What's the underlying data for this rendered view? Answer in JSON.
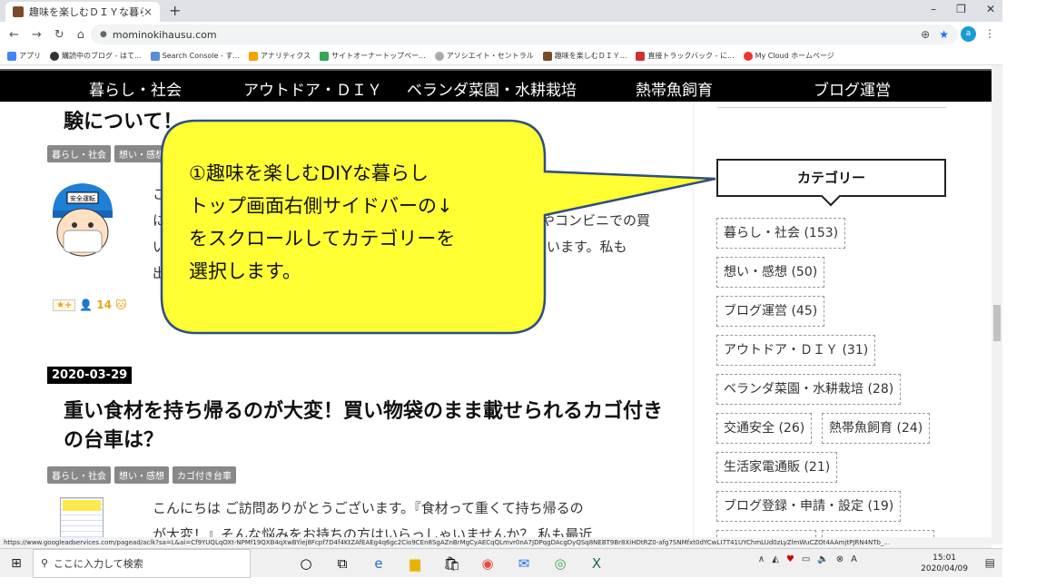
{
  "browser": {
    "tab_title": "趣味を楽しむＤＩＹな暮らし",
    "tab_close": "×",
    "new_tab": "+",
    "win_min": "–",
    "win_max": "❐",
    "win_close": "✕",
    "url": "mominokihausu.com",
    "profile_initial": "a",
    "bookmarks": [
      "アプリ",
      "購読中のブログ - はて...",
      "Search Console - す...",
      "アナリティクス",
      "サイトオーナートップペー...",
      "アソシエイト・セントラル",
      "趣味を楽しむＤＩＹ...",
      "直接トラックバック - に...",
      "My Cloud ホームページ"
    ]
  },
  "site_nav": [
    "暮らし・社会",
    "アウトドア・ＤＩＹ",
    "ベランダ菜園・水耕栽培",
    "熱帯魚飼育",
    "ブログ運営"
  ],
  "post1": {
    "title_partial": "験について！",
    "tags": [
      "暮らし・社会",
      "想い・感想"
    ],
    "avatar_badge": "安全運転",
    "excerpt": [
      "こ",
      "に",
      "い",
      "出"
    ],
    "excerpt_right": [
      "やコンビニでの買",
      "けています。私も"
    ],
    "hatena_star": "★+",
    "hatena_count": "14"
  },
  "post2": {
    "date": "2020-03-29",
    "title": "重い食材を持ち帰るのが大変！買い物袋のまま載せられるカゴ付きの台車は？",
    "tags": [
      "暮らし・社会",
      "想い・感想",
      "カゴ付き台車"
    ],
    "excerpt": [
      "こんにちは ご訪問ありがとうございます。『食材って重くて持ち帰るの",
      "が大変！』そんな悩みをお持ちの方はいらっしゃいませんか？ 私も最近"
    ]
  },
  "callout": {
    "text": "①趣味を楽しむDIYな暮らしトップ画面右側サイドバーの↓をスクロールしてカテゴリーを選択します。",
    "lines": [
      "①趣味を楽しむDIYな暮らし",
      "トップ画面右側サイドバーの↓",
      "をスクロールしてカテゴリーを",
      "選択します。"
    ]
  },
  "sidebar": {
    "category_heading": "カテゴリー",
    "categories": [
      "暮らし・社会 (153)",
      "想い・感想 (50)",
      "ブログ運営 (45)",
      "アウトドア・ＤＩＹ (31)",
      "ベランダ菜園・水耕栽培 (28)",
      "交通安全 (26)",
      "熱帯魚飼育 (24)",
      "生活家電通販 (21)",
      "ブログ登録・申請・設定 (19)"
    ]
  },
  "status_url": "https://www.googleadservices.com/pagead/aclk?sa=L&ai=Cf9YUQLqOXt-NPMf19QXB4qXwBYiej8Fcpf7D4f4KtZAfEAEg4q6gc2Cio9CEn8SgAZnBrMgCyAECqQLmvr0nA7JDPqgDAcgDyQSq8NEBT9Br8XiHDtRZ0-afg7SNMfxt0dYCwLI7T41UYChmLUd0zLyZlmWuCZOt4AAmjtPJRN4NTb_...",
  "taskbar": {
    "search_placeholder": "ここに入力して検索",
    "time": "15:01",
    "date": "2020/04/09",
    "ime": "A"
  },
  "colors": {
    "callout_fill": "#ffff33",
    "callout_stroke": "#2f4f7f",
    "nav_bg": "#000000",
    "tag_bg": "#888888"
  }
}
